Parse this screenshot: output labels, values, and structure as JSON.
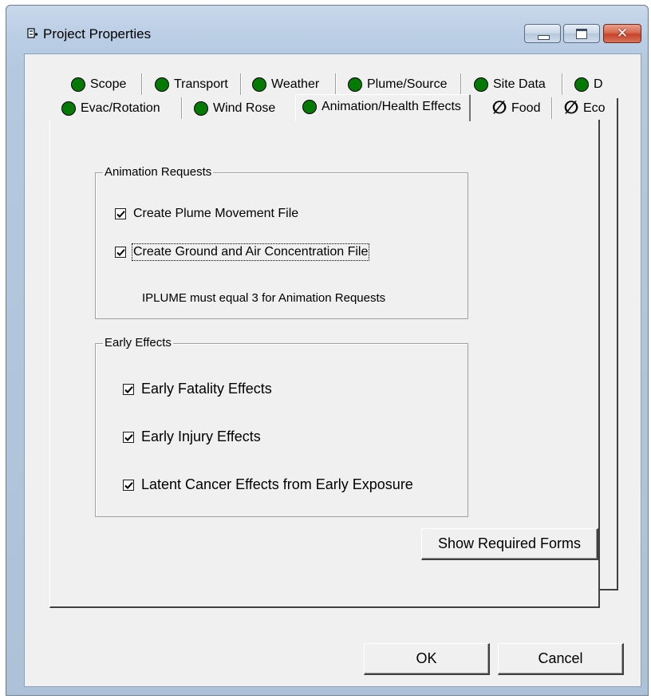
{
  "window": {
    "title": "Project Properties"
  },
  "tabs": {
    "row1": [
      {
        "label": "Scope",
        "status": "green"
      },
      {
        "label": "Transport",
        "status": "green"
      },
      {
        "label": "Weather",
        "status": "green"
      },
      {
        "label": "Plume/Source",
        "status": "green"
      },
      {
        "label": "Site Data",
        "status": "green"
      },
      {
        "label": "D",
        "status": "green"
      }
    ],
    "row2": [
      {
        "label": "Evac/Rotation",
        "status": "green"
      },
      {
        "label": "Wind Rose",
        "status": "green"
      },
      {
        "label": "Animation/Health Effects",
        "status": "green",
        "selected": true
      },
      {
        "label": "Food",
        "status": "none"
      },
      {
        "label": "Eco",
        "status": "none"
      }
    ],
    "status_colors": {
      "green": "#047a04"
    }
  },
  "animation_requests": {
    "title": "Animation Requests",
    "plume_movement": {
      "label": "Create Plume Movement File",
      "checked": true
    },
    "ground_air": {
      "label": "Create Ground and Air Concentration File",
      "checked": true
    },
    "note": "IPLUME must equal 3 for Animation Requests"
  },
  "early_effects": {
    "title": "Early Effects",
    "fatality": {
      "label": "Early Fatality Effects",
      "checked": true
    },
    "injury": {
      "label": "Early Injury Effects",
      "checked": true
    },
    "latent_cancer": {
      "label": "Latent Cancer Effects from Early Exposure",
      "checked": true
    }
  },
  "buttons": {
    "show_required_forms": "Show Required Forms",
    "ok": "OK",
    "cancel": "Cancel"
  }
}
